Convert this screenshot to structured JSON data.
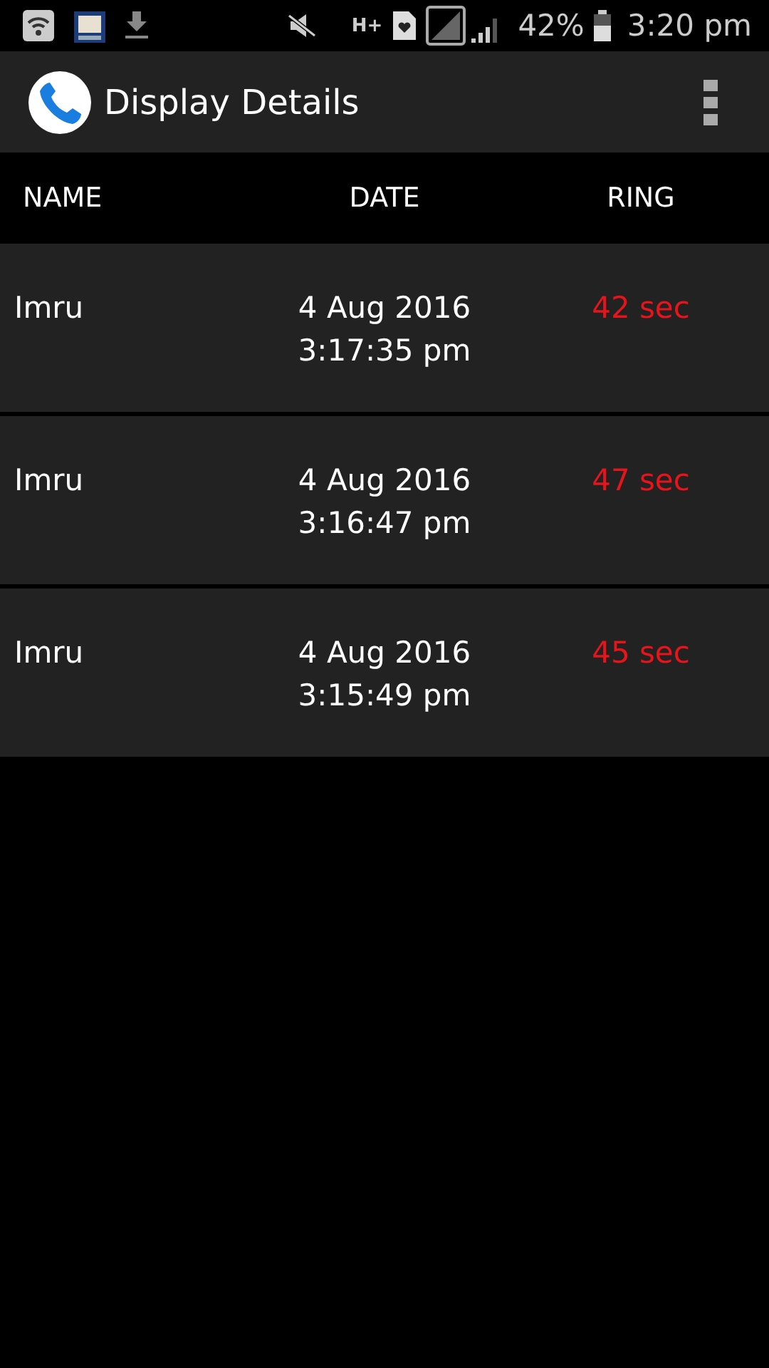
{
  "status_bar": {
    "network_type": "H+",
    "battery": "42%",
    "time": "3:20 pm"
  },
  "app_bar": {
    "title": "Display Details"
  },
  "table": {
    "columns": [
      "NAME",
      "DATE",
      "RING"
    ],
    "rows": [
      {
        "name": "Imru",
        "date": "4 Aug 2016",
        "time": "3:17:35 pm",
        "ring": "42 sec"
      },
      {
        "name": "Imru",
        "date": "4 Aug 2016",
        "time": "3:16:47 pm",
        "ring": "47 sec"
      },
      {
        "name": "Imru",
        "date": "4 Aug 2016",
        "time": "3:15:49 pm",
        "ring": "45 sec"
      }
    ]
  }
}
